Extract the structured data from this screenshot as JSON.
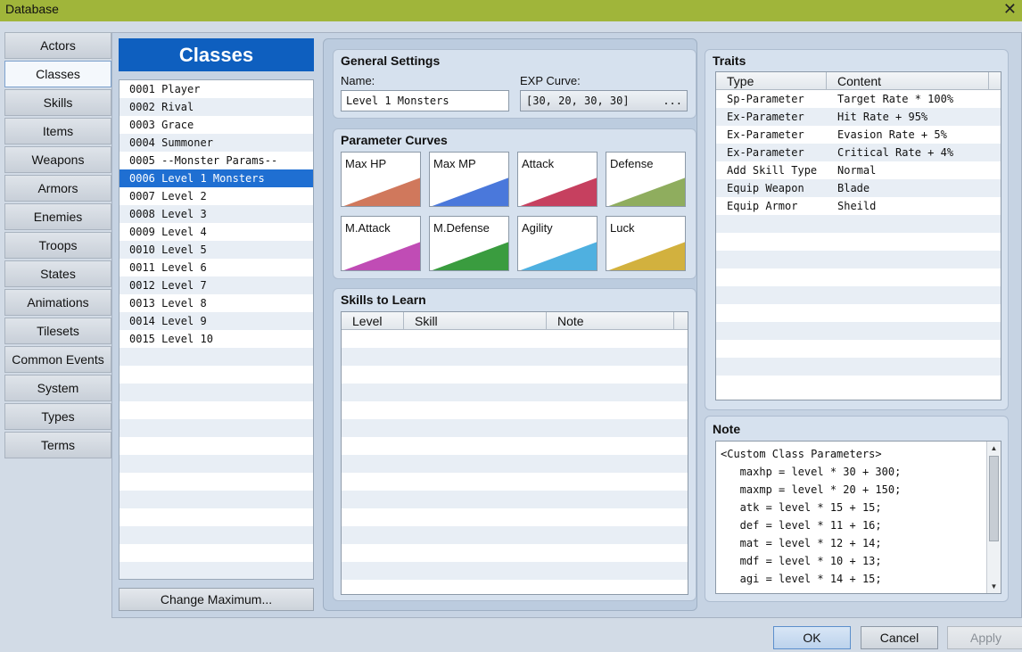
{
  "window": {
    "title": "Database"
  },
  "nav": {
    "items": [
      "Actors",
      "Classes",
      "Skills",
      "Items",
      "Weapons",
      "Armors",
      "Enemies",
      "Troops",
      "States",
      "Animations",
      "Tilesets",
      "Common Events",
      "System",
      "Types",
      "Terms"
    ],
    "active": "Classes"
  },
  "classes": {
    "header": "Classes",
    "items": [
      "0001 Player",
      "0002 Rival",
      "0003 Grace",
      "0004 Summoner",
      "0005 --Monster Params--",
      "0006 Level 1 Monsters",
      "0007 Level 2",
      "0008 Level 3",
      "0009 Level 4",
      "0010 Level 5",
      "0011 Level 6",
      "0012 Level 7",
      "0013 Level 8",
      "0014 Level 9",
      "0015 Level 10"
    ],
    "selected": "0006 Level 1 Monsters",
    "change_max_label": "Change Maximum..."
  },
  "general": {
    "title": "General Settings",
    "name_label": "Name:",
    "name_value": "Level 1 Monsters",
    "exp_label": "EXP Curve:",
    "exp_value": "[30, 20, 30, 30]",
    "exp_button": "..."
  },
  "curves": {
    "title": "Parameter Curves",
    "items": [
      {
        "name": "Max HP",
        "color": "#d0785c"
      },
      {
        "name": "Max MP",
        "color": "#4a78db"
      },
      {
        "name": "Attack",
        "color": "#c6405f"
      },
      {
        "name": "Defense",
        "color": "#8fad5e"
      },
      {
        "name": "M.Attack",
        "color": "#c04cb5"
      },
      {
        "name": "M.Defense",
        "color": "#3a9c3f"
      },
      {
        "name": "Agility",
        "color": "#4fb0e0"
      },
      {
        "name": "Luck",
        "color": "#d2b13e"
      }
    ]
  },
  "skills": {
    "title": "Skills to Learn",
    "columns": [
      "Level",
      "Skill",
      "Note"
    ]
  },
  "traits": {
    "title": "Traits",
    "columns": [
      "Type",
      "Content"
    ],
    "rows": [
      [
        "Sp-Parameter",
        "Target Rate * 100%"
      ],
      [
        "Ex-Parameter",
        "Hit Rate + 95%"
      ],
      [
        "Ex-Parameter",
        "Evasion Rate + 5%"
      ],
      [
        "Ex-Parameter",
        "Critical Rate + 4%"
      ],
      [
        "Add Skill Type",
        "Normal"
      ],
      [
        "Equip Weapon",
        "Blade"
      ],
      [
        "Equip Armor",
        "Sheild"
      ]
    ]
  },
  "note": {
    "title": "Note",
    "lines": [
      "<Custom Class Parameters>",
      "   maxhp = level * 30 + 300;",
      "   maxmp = level * 20 + 150;",
      "   atk = level * 15 + 15;",
      "   def = level * 11 + 16;",
      "   mat = level * 12 + 14;",
      "   mdf = level * 10 + 13;",
      "   agi = level * 14 + 15;"
    ]
  },
  "buttons": {
    "ok": "OK",
    "cancel": "Cancel",
    "apply": "Apply"
  }
}
